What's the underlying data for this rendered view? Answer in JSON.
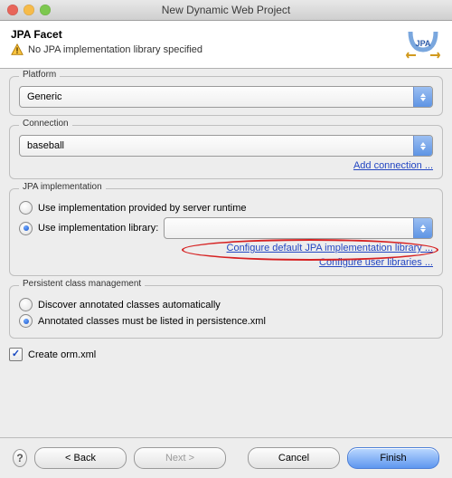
{
  "window": {
    "title": "New Dynamic Web Project"
  },
  "traffic": {
    "close": "#e8655a",
    "min": "#f6bb4a",
    "zoom": "#7dc84f"
  },
  "banner": {
    "title": "JPA Facet",
    "message": "No JPA implementation library specified",
    "icon_name": "warning-icon",
    "logo_name": "jpa-icon"
  },
  "platform": {
    "legend": "Platform",
    "value": "Generic"
  },
  "connection": {
    "legend": "Connection",
    "value": "baseball",
    "add_link": "Add connection ..."
  },
  "impl": {
    "legend": "JPA implementation",
    "opt_server": "Use implementation provided by server runtime",
    "opt_library": "Use implementation library:",
    "selected": "library",
    "library_value": "",
    "link_default": "Configure default JPA implementation library ...",
    "link_user": "Configure user libraries ..."
  },
  "pcm": {
    "legend": "Persistent class management",
    "opt_discover": "Discover annotated classes automatically",
    "opt_listed": "Annotated classes must be listed in persistence.xml",
    "selected": "listed"
  },
  "create_orm": {
    "label": "Create orm.xml",
    "checked": true
  },
  "footer": {
    "back": "< Back",
    "next": "Next >",
    "cancel": "Cancel",
    "finish": "Finish"
  }
}
